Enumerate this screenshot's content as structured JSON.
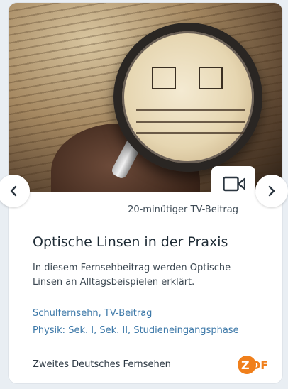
{
  "media": {
    "duration_label": "20-minütiger TV-Beitrag",
    "title": "Optische Linsen in der Praxis",
    "description": "In diesem Fernsehbeitrag werden Optische Linsen an Alltagsbeispielen erklärt.",
    "tags": [
      "Schulfernsehn, TV-Beitrag",
      "Physik: Sek. I, Sek. II, Studieneingangsphase"
    ],
    "publisher": "Zweites Deutsches Fernsehen",
    "logo_text": "ZDF",
    "type_icon": "video-camera-icon"
  },
  "navigation": {
    "prev_icon": "chevron-left-icon",
    "next_icon": "chevron-right-icon"
  },
  "colors": {
    "link": "#3c78a8",
    "zdf_orange": "#f07f1b"
  }
}
